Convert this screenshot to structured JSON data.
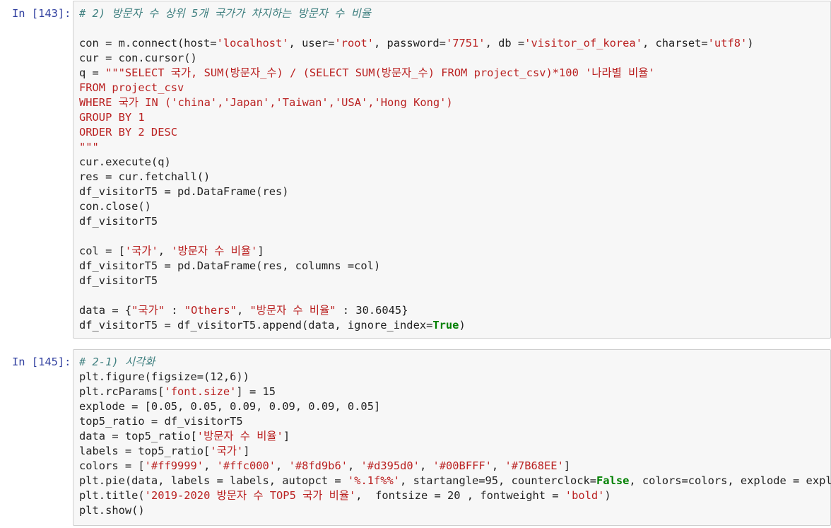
{
  "cells": [
    {
      "prompt": "In [143]:",
      "lines": [
        [
          {
            "t": "# 2) 방문자 수 상위 5개 국가가 차지하는 방문자 수 비율",
            "c": "cm"
          }
        ],
        [],
        [
          {
            "t": "con = m.connect(host=",
            "c": "nm"
          },
          {
            "t": "'localhost'",
            "c": "s"
          },
          {
            "t": ", user=",
            "c": "nm"
          },
          {
            "t": "'root'",
            "c": "s"
          },
          {
            "t": ", password=",
            "c": "nm"
          },
          {
            "t": "'7751'",
            "c": "s"
          },
          {
            "t": ", db =",
            "c": "nm"
          },
          {
            "t": "'visitor_of_korea'",
            "c": "s"
          },
          {
            "t": ", charset=",
            "c": "nm"
          },
          {
            "t": "'utf8'",
            "c": "s"
          },
          {
            "t": ")",
            "c": "nm"
          }
        ],
        [
          {
            "t": "cur = con.cursor()",
            "c": "nm"
          }
        ],
        [
          {
            "t": "q = ",
            "c": "nm"
          },
          {
            "t": "\"\"\"SELECT 국가, SUM(방문자_수) / (SELECT SUM(방문자_수) FROM project_csv)*100 '나라별 비율'",
            "c": "s"
          }
        ],
        [
          {
            "t": "FROM project_csv",
            "c": "s"
          }
        ],
        [
          {
            "t": "WHERE 국가 IN ('china','Japan','Taiwan','USA','Hong Kong')",
            "c": "s"
          }
        ],
        [
          {
            "t": "GROUP BY 1",
            "c": "s"
          }
        ],
        [
          {
            "t": "ORDER BY 2 DESC",
            "c": "s"
          }
        ],
        [
          {
            "t": "\"\"\"",
            "c": "s"
          }
        ],
        [
          {
            "t": "cur.execute(q)",
            "c": "nm"
          }
        ],
        [
          {
            "t": "res = cur.fetchall()",
            "c": "nm"
          }
        ],
        [
          {
            "t": "df_visitorT5 = pd.DataFrame(res)",
            "c": "nm"
          }
        ],
        [
          {
            "t": "con.close()",
            "c": "nm"
          }
        ],
        [
          {
            "t": "df_visitorT5",
            "c": "nm"
          }
        ],
        [],
        [
          {
            "t": "col = [",
            "c": "nm"
          },
          {
            "t": "'국가'",
            "c": "s"
          },
          {
            "t": ", ",
            "c": "nm"
          },
          {
            "t": "'방문자 수 비율'",
            "c": "s"
          },
          {
            "t": "]",
            "c": "nm"
          }
        ],
        [
          {
            "t": "df_visitorT5 = pd.DataFrame(res, columns =col)",
            "c": "nm"
          }
        ],
        [
          {
            "t": "df_visitorT5",
            "c": "nm"
          }
        ],
        [],
        [
          {
            "t": "data = {",
            "c": "nm"
          },
          {
            "t": "\"국가\"",
            "c": "s"
          },
          {
            "t": " : ",
            "c": "nm"
          },
          {
            "t": "\"Others\"",
            "c": "s"
          },
          {
            "t": ", ",
            "c": "nm"
          },
          {
            "t": "\"방문자 수 비율\"",
            "c": "s"
          },
          {
            "t": " : 30.6045}",
            "c": "nm"
          }
        ],
        [
          {
            "t": "df_visitorT5 = df_visitorT5.append(data, ignore_index=",
            "c": "nm"
          },
          {
            "t": "True",
            "c": "kw"
          },
          {
            "t": ")",
            "c": "nm"
          }
        ]
      ]
    },
    {
      "prompt": "In [145]:",
      "lines": [
        [
          {
            "t": "# 2-1) 시각화",
            "c": "cm"
          }
        ],
        [
          {
            "t": "plt.figure(figsize=(12,6))",
            "c": "nm"
          }
        ],
        [
          {
            "t": "plt.rcParams[",
            "c": "nm"
          },
          {
            "t": "'font.size'",
            "c": "s"
          },
          {
            "t": "] = 15",
            "c": "nm"
          }
        ],
        [
          {
            "t": "explode = [0.05, 0.05, 0.09, 0.09, 0.09, 0.05]",
            "c": "nm"
          }
        ],
        [
          {
            "t": "top5_ratio = df_visitorT5",
            "c": "nm"
          }
        ],
        [
          {
            "t": "data = top5_ratio[",
            "c": "nm"
          },
          {
            "t": "'방문자 수 비율'",
            "c": "s"
          },
          {
            "t": "]",
            "c": "nm"
          }
        ],
        [
          {
            "t": "labels = top5_ratio[",
            "c": "nm"
          },
          {
            "t": "'국가'",
            "c": "s"
          },
          {
            "t": "]",
            "c": "nm"
          }
        ],
        [
          {
            "t": "colors = [",
            "c": "nm"
          },
          {
            "t": "'#ff9999'",
            "c": "s"
          },
          {
            "t": ", ",
            "c": "nm"
          },
          {
            "t": "'#ffc000'",
            "c": "s"
          },
          {
            "t": ", ",
            "c": "nm"
          },
          {
            "t": "'#8fd9b6'",
            "c": "s"
          },
          {
            "t": ", ",
            "c": "nm"
          },
          {
            "t": "'#d395d0'",
            "c": "s"
          },
          {
            "t": ", ",
            "c": "nm"
          },
          {
            "t": "'#00BFFF'",
            "c": "s"
          },
          {
            "t": ", ",
            "c": "nm"
          },
          {
            "t": "'#7B68EE'",
            "c": "s"
          },
          {
            "t": "]",
            "c": "nm"
          }
        ],
        [
          {
            "t": "plt.pie(data, labels = labels, autopct = ",
            "c": "nm"
          },
          {
            "t": "'%.1f%%'",
            "c": "s"
          },
          {
            "t": ", startangle=95, counterclock=",
            "c": "nm"
          },
          {
            "t": "False",
            "c": "kw"
          },
          {
            "t": ", colors=colors, explode = explode)",
            "c": "nm"
          }
        ],
        [
          {
            "t": "plt.title(",
            "c": "nm"
          },
          {
            "t": "'2019-2020 방문자 수 TOP5 국가 비율'",
            "c": "s"
          },
          {
            "t": ",  fontsize = 20 , fontweight = ",
            "c": "nm"
          },
          {
            "t": "'bold'",
            "c": "s"
          },
          {
            "t": ")",
            "c": "nm"
          }
        ],
        [
          {
            "t": "plt.show()",
            "c": "nm"
          }
        ]
      ]
    }
  ]
}
